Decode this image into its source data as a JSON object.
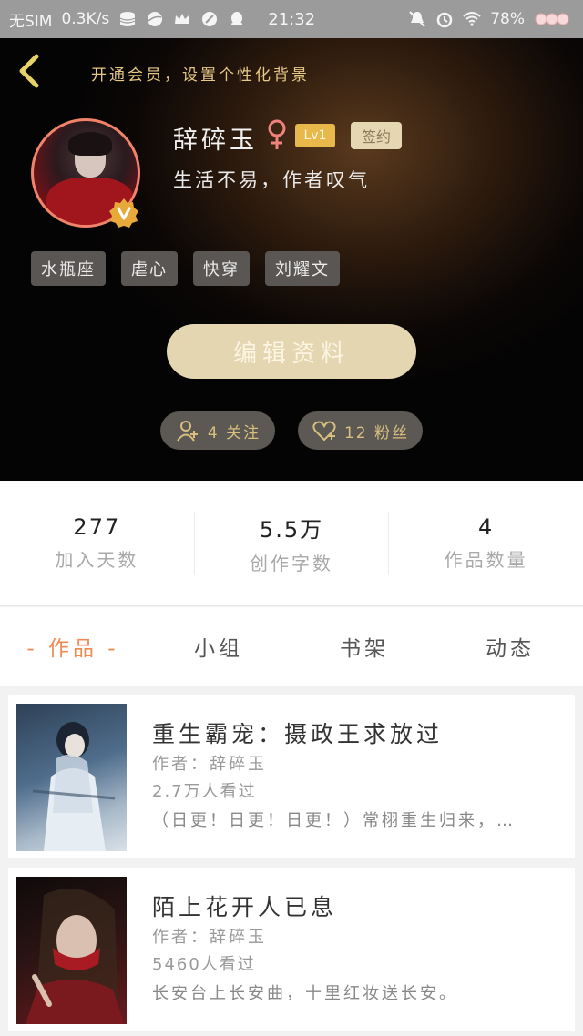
{
  "status_bar": {
    "carrier": "无SIM",
    "speed": "0.3K/s",
    "time": "21:32",
    "battery": "78%"
  },
  "header": {
    "back_icon": "chevron-left-icon",
    "vip_hint": "开通会员，设置个性化背景",
    "username": "辞碎玉",
    "gender_icon": "female-icon",
    "level": "Lv1",
    "signed": "签约",
    "motto": "生活不易，作者叹气",
    "tags": [
      "水瓶座",
      "虐心",
      "快穿",
      "刘耀文"
    ],
    "edit_button": "编辑资料",
    "following": "4 关注",
    "fans": "12 粉丝",
    "colors": {
      "accent": "#e7c987",
      "avatar_ring": "#f0836a",
      "lv_badge": "#e8b84a"
    }
  },
  "stats": [
    {
      "value": "277",
      "label": "加入天数"
    },
    {
      "value": "5.5万",
      "label": "创作字数"
    },
    {
      "value": "4",
      "label": "作品数量"
    }
  ],
  "tabs": [
    {
      "label": "- 作品 -",
      "active": true
    },
    {
      "label": "小组",
      "active": false
    },
    {
      "label": "书架",
      "active": false
    },
    {
      "label": "动态",
      "active": false
    }
  ],
  "books": [
    {
      "title": "重生霸宠：摄政王求放过",
      "author": "作者：辞碎玉",
      "views": "2.7万人看过",
      "desc": "（日更！日更！日更！）常栩重生归来，…"
    },
    {
      "title": "陌上花开人已息",
      "author": "作者：辞碎玉",
      "views": "5460人看过",
      "desc": "长安台上长安曲，十里红妆送长安。"
    }
  ]
}
